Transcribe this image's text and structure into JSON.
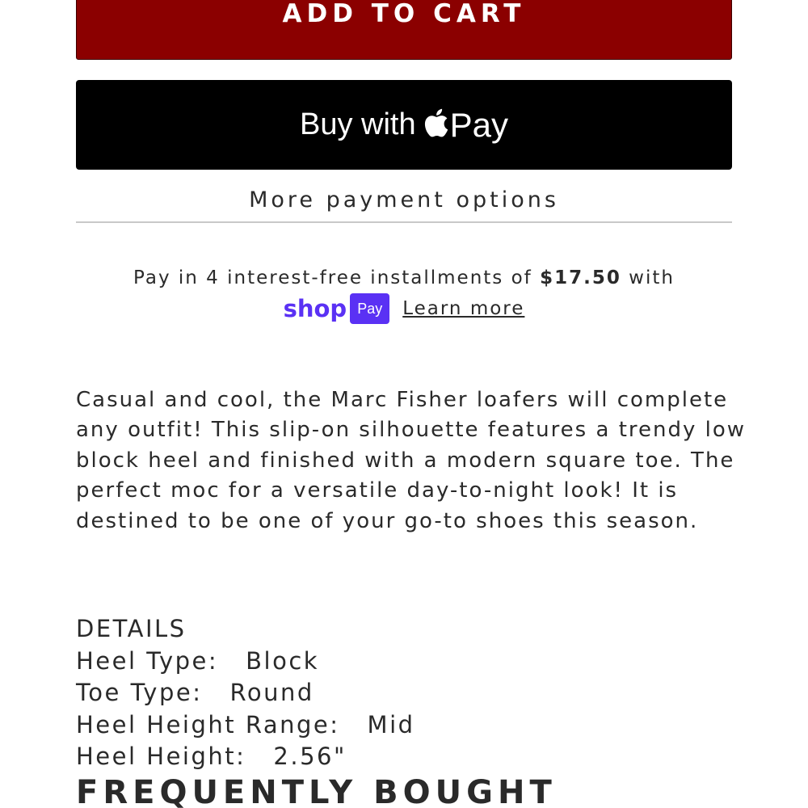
{
  "buttons": {
    "add_to_cart": "ADD TO CART",
    "apple_pay_prefix": "Buy with",
    "apple_pay_word": "Pay",
    "more_payment_options": "More payment options"
  },
  "installments": {
    "text_before": "Pay in 4 interest-free installments of",
    "amount": "$17.50",
    "text_after": "with",
    "shop_logo": "shop",
    "pay_badge": "Pay",
    "learn_more": "Learn more"
  },
  "description": "Casual and cool, the Marc Fisher loafers will complete any outfit! This slip-on silhouette features a trendy low block heel and finished with a modern square toe. The perfect moc for a versatile day-to-night look! It is destined to be one of your go-to shoes this season.",
  "details": {
    "heading": "DETAILS",
    "rows": [
      {
        "label": "Heel Type:",
        "value": "Block"
      },
      {
        "label": "Toe Type:",
        "value": "Round"
      },
      {
        "label": "Heel Height Range:",
        "value": "Mid"
      },
      {
        "label": "Heel Height:",
        "value": "2.56\""
      }
    ]
  },
  "section_heading": "FREQUENTLY BOUGHT",
  "colors": {
    "add_to_cart_bg": "#8b0000",
    "apple_pay_bg": "#000000",
    "shop_purple": "#5a31f4"
  },
  "icons": {
    "apple": "apple-icon"
  }
}
